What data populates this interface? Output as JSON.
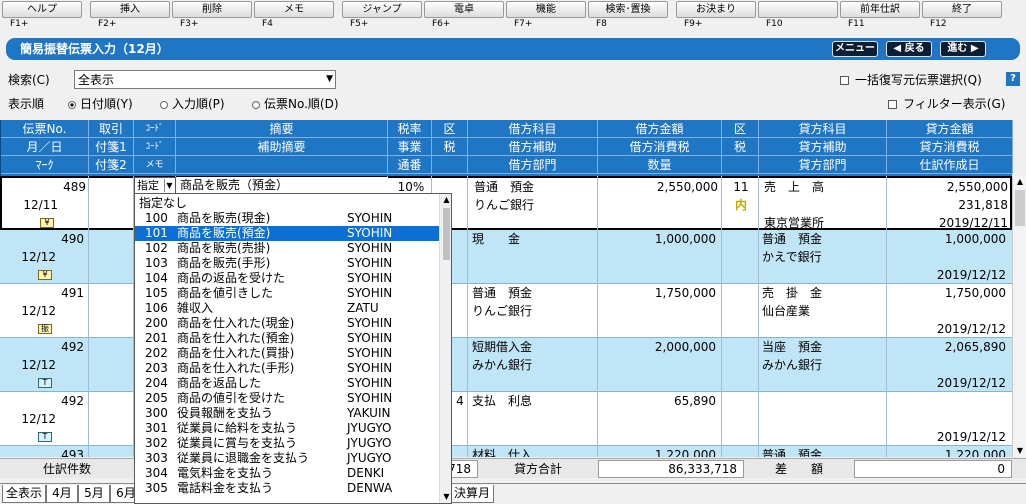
{
  "fkeys": [
    {
      "label": "ヘルプ",
      "key": "F1+"
    },
    {
      "label": "挿入",
      "key": "F2+"
    },
    {
      "label": "削除",
      "key": "F3+"
    },
    {
      "label": "メモ",
      "key": "F4"
    },
    {
      "label": "ジャンプ",
      "key": "F5+"
    },
    {
      "label": "電卓",
      "key": "F6+"
    },
    {
      "label": "機能",
      "key": "F7+"
    },
    {
      "label": "検索･置換",
      "key": "F8"
    },
    {
      "label": "お決まり",
      "key": "F9+"
    },
    {
      "label": "",
      "key": "F10"
    },
    {
      "label": "前年仕訳",
      "key": "F11"
    },
    {
      "label": "終了",
      "key": "F12"
    }
  ],
  "title": "簡易振替伝票入力（12月）",
  "nav": {
    "menu": "メニュー",
    "back": "◀ 戻る",
    "next": "進む ▶"
  },
  "search": {
    "label": "検索(C)",
    "value": "全表示"
  },
  "bulk_restore": "一括復写元伝票選択(Q)",
  "help_icon": "?",
  "order": {
    "label": "表示順",
    "opt1": "日付順(Y)",
    "opt2": "入力順(P)",
    "opt3": "伝票No.順(D)"
  },
  "filter": "フィルター表示(G)",
  "header": {
    "r1": [
      "伝票No.",
      "取引",
      "ｺｰﾄﾞ",
      "摘要",
      "税率",
      "区",
      "借方科目",
      "借方金額",
      "区",
      "貸方科目",
      "貸方金額"
    ],
    "r2": [
      "月／日",
      "付箋1",
      "ｺｰﾄﾞ",
      "補助摘要",
      "事業",
      "税",
      "借方補助",
      "借方消費税",
      "税",
      "貸方補助",
      "貸方消費税"
    ],
    "r3": [
      "ﾏｰｸ",
      "付箋2",
      "メモ",
      "",
      "通番",
      "",
      "借方部門",
      "数量",
      "",
      "貸方部門",
      "仕訳作成日"
    ]
  },
  "rows": [
    {
      "no": "489",
      "date": "12/11",
      "mark": "¥",
      "code": "",
      "desc": "商品を販売（預金）",
      "rate": "10%",
      "dacct": "普通　預金",
      "dsub": "りんご銀行",
      "damt": "2,550,000",
      "ctax": "11",
      "ctaxsub": "内",
      "cacct": "売　上　高",
      "csub": "",
      "cdept": "東京営業所",
      "camt": "2,550,000",
      "ctx": "231,818",
      "created": "2019/12/11"
    },
    {
      "no": "490",
      "date": "12/12",
      "mark": "¥",
      "code": "",
      "desc": "",
      "rate": "",
      "dacct": "現　　金",
      "dsub": "",
      "damt": "1,000,000",
      "ctax": "",
      "ctaxsub": "",
      "cacct": "普通　預金",
      "csub": "かえで銀行",
      "cdept": "",
      "camt": "1,000,000",
      "ctx": "",
      "created": "2019/12/12"
    },
    {
      "no": "491",
      "date": "12/12",
      "mark": "振",
      "code": "",
      "desc": "",
      "rate": "",
      "dacct": "普通　預金",
      "dsub": "りんご銀行",
      "damt": "1,750,000",
      "ctax": "",
      "ctaxsub": "",
      "cacct": "売　掛　金",
      "csub": "仙台産業",
      "cdept": "",
      "camt": "1,750,000",
      "ctx": "",
      "created": "2019/12/12"
    },
    {
      "no": "492",
      "date": "12/12",
      "mark": "T",
      "code": "",
      "desc": "",
      "rate": "",
      "dacct": "短期借入金",
      "dsub": "みかん銀行",
      "damt": "2,000,000",
      "ctax": "",
      "ctaxsub": "",
      "cacct": "当座　預金",
      "csub": "みかん銀行",
      "cdept": "",
      "camt": "2,065,890",
      "ctx": "",
      "created": "2019/12/12"
    },
    {
      "no": "492",
      "date": "12/12",
      "mark": "T",
      "code": "4",
      "desc": "",
      "rate": "",
      "dacct": "支払　利息",
      "dsub": "",
      "damt": "65,890",
      "ctax": "",
      "ctaxsub": "",
      "cacct": "",
      "csub": "",
      "cdept": "",
      "camt": "",
      "ctx": "",
      "created": "2019/12/12"
    },
    {
      "no": "493",
      "date": "",
      "mark": "",
      "code": "",
      "desc": "",
      "rate": "",
      "dacct": "材料　仕入",
      "dsub": "",
      "damt": "1,220,000",
      "ctax": "",
      "ctaxsub": "",
      "cacct": "普通　預金",
      "csub": "",
      "cdept": "",
      "camt": "1,220,000",
      "ctx": "",
      "created": ""
    }
  ],
  "edit": {
    "sel": "指定",
    "text": "商品を販売（預金）"
  },
  "dropdown": {
    "none": "指定なし",
    "items": [
      {
        "code": "100",
        "name": "商品を販売(現金)",
        "kana": "SYOHIN"
      },
      {
        "code": "101",
        "name": "商品を販売(預金)",
        "kana": "SYOHIN"
      },
      {
        "code": "102",
        "name": "商品を販売(売掛)",
        "kana": "SYOHIN"
      },
      {
        "code": "103",
        "name": "商品を販売(手形)",
        "kana": "SYOHIN"
      },
      {
        "code": "104",
        "name": "商品の返品を受けた",
        "kana": "SYOHIN"
      },
      {
        "code": "105",
        "name": "商品を値引きした",
        "kana": "SYOHIN"
      },
      {
        "code": "106",
        "name": "雑収入",
        "kana": "ZATU"
      },
      {
        "code": "200",
        "name": "商品を仕入れた(現金)",
        "kana": "SYOHIN"
      },
      {
        "code": "201",
        "name": "商品を仕入れた(預金)",
        "kana": "SYOHIN"
      },
      {
        "code": "202",
        "name": "商品を仕入れた(買掛)",
        "kana": "SYOHIN"
      },
      {
        "code": "203",
        "name": "商品を仕入れた(手形)",
        "kana": "SYOHIN"
      },
      {
        "code": "204",
        "name": "商品を返品した",
        "kana": "SYOHIN"
      },
      {
        "code": "205",
        "name": "商品の値引を受けた",
        "kana": "SYOHIN"
      },
      {
        "code": "300",
        "name": "役員報酬を支払う",
        "kana": "YAKUIN"
      },
      {
        "code": "301",
        "name": "従業員に給料を支払う",
        "kana": "JYUGYO"
      },
      {
        "code": "302",
        "name": "従業員に賞与を支払う",
        "kana": "JYUGYO"
      },
      {
        "code": "303",
        "name": "従業員に退職金を支払う",
        "kana": "JYUGYO"
      },
      {
        "code": "304",
        "name": "電気料金を支払う",
        "kana": "DENKI"
      },
      {
        "code": "305",
        "name": "電話料金を支払う",
        "kana": "DENWA"
      }
    ],
    "selected_index": 1
  },
  "totals": {
    "count_label": "仕訳件数",
    "partial": "718",
    "credit_label": "貸方合計",
    "credit": "86,333,718",
    "diff_label": "差　　額",
    "diff": "0"
  },
  "tabs": [
    "全表示",
    "4月",
    "5月",
    "6月",
    "決算月"
  ]
}
